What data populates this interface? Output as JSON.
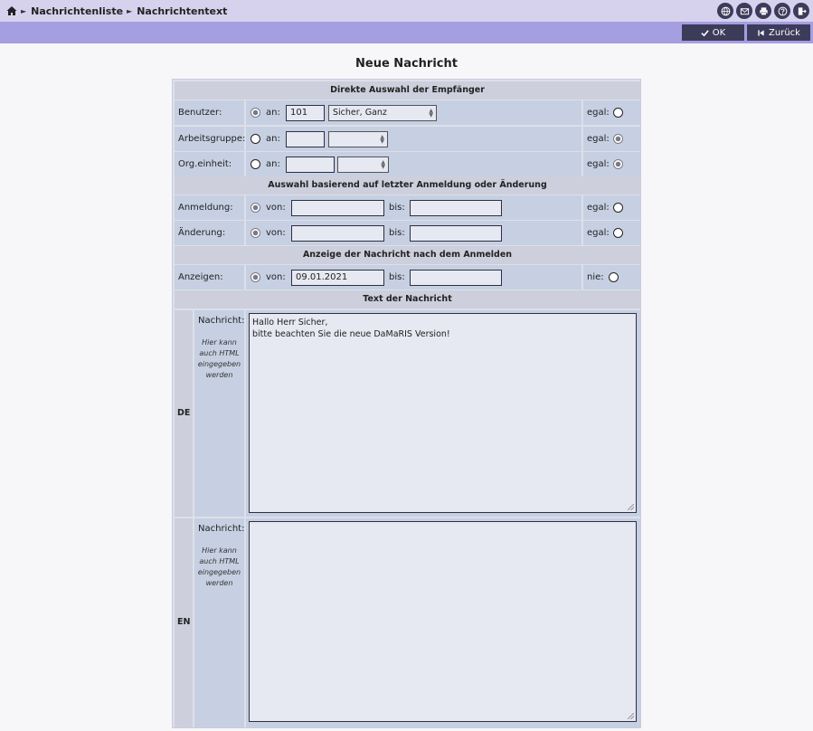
{
  "breadcrumb": {
    "home_icon": "home-icon",
    "items": [
      "Nachrichtenliste",
      "Nachrichtentext"
    ]
  },
  "toolbar": {
    "icons": [
      "globe-icon",
      "mail-icon",
      "printer-icon",
      "help-icon",
      "logout-icon"
    ],
    "ok_label": "OK",
    "back_label": "Zurück"
  },
  "title": "Neue Nachricht",
  "sections": {
    "recipients": "Direkte Auswahl der Empfänger",
    "activity": "Auswahl basierend auf letzter Anmeldung oder Änderung",
    "display": "Anzeige der Nachricht nach dem Anmelden",
    "text": "Text der Nachricht"
  },
  "recipients": {
    "user": {
      "label": "Benutzer:",
      "an": "an:",
      "id_value": "101",
      "name_value": "Sicher, Ganz",
      "egal": "egal:",
      "selected": "an"
    },
    "workgroup": {
      "label": "Arbeitsgruppe:",
      "an": "an:",
      "id_value": "",
      "name_value": "",
      "egal": "egal:",
      "selected": "egal"
    },
    "orgunit": {
      "label": "Org.einheit:",
      "an": "an:",
      "id_value": "",
      "name_value": "",
      "egal": "egal:",
      "selected": "egal"
    }
  },
  "activity": {
    "login": {
      "label": "Anmeldung:",
      "von": "von:",
      "from_value": "",
      "bis": "bis:",
      "to_value": "",
      "egal": "egal:",
      "selected": "von"
    },
    "change": {
      "label": "Änderung:",
      "von": "von:",
      "from_value": "",
      "bis": "bis:",
      "to_value": "",
      "egal": "egal:",
      "selected": "von"
    }
  },
  "display": {
    "label": "Anzeigen:",
    "von": "von:",
    "from_value": "09.01.2021",
    "bis": "bis:",
    "to_value": "",
    "nie": "nie:",
    "selected": "von"
  },
  "messages": [
    {
      "lang": "DE",
      "label": "Nachricht:",
      "hint": "Hier kann auch HTML eingegeben werden",
      "text": "Hallo Herr Sicher,\nbitte beachten Sie die neue DaMaRIS Version!"
    },
    {
      "lang": "EN",
      "label": "Nachricht:",
      "hint": "Hier kann auch HTML eingegeben werden",
      "text": ""
    }
  ],
  "colors": {
    "header_bar": "#d6d2ee",
    "action_bar": "#a59ee0",
    "button": "#3d3b5a",
    "cell": "#c6d0e2"
  }
}
